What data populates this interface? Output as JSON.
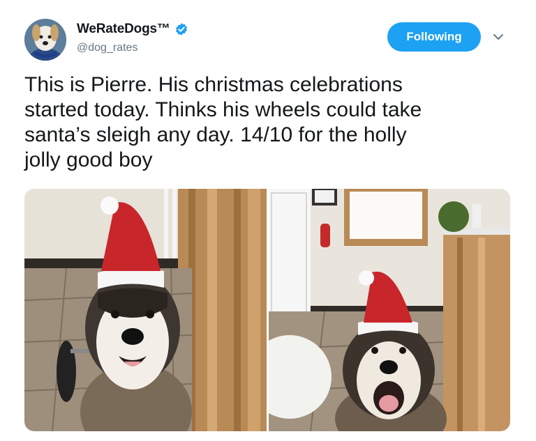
{
  "author": {
    "display_name": "WeRateDogs™",
    "handle": "@dog_rates",
    "verified": true,
    "avatar_icon": "dog-avatar-icon"
  },
  "actions": {
    "follow_label": "Following",
    "menu_icon": "chevron-down-icon"
  },
  "tweet": {
    "text": "This is Pierre. His christmas celebrations\nstarted today. Thinks his wheels could take\nsanta’s sleigh any day. 14/10 for the holly\njolly good boy"
  },
  "colors": {
    "accent": "#1da1f2",
    "secondary_text": "#657786",
    "primary_text": "#14171a"
  },
  "media": [
    {
      "subject": "dog-in-santa-hat-photo-1"
    },
    {
      "subject": "dog-in-santa-hat-photo-2"
    }
  ]
}
